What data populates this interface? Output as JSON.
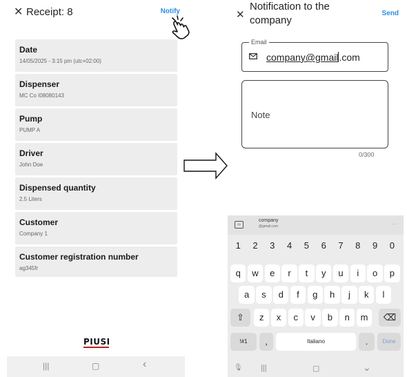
{
  "left": {
    "title": "Receipt: 8",
    "notify_label": "Notify",
    "close_icon": "close-icon",
    "cards": [
      {
        "label": "Date",
        "value": "14/05/2025 - 3:15 pm (utc+02:00)"
      },
      {
        "label": "Dispenser",
        "value": "MC Co  I08080143"
      },
      {
        "label": "Pump",
        "value": "PUMP A"
      },
      {
        "label": "Driver",
        "value": "John Doe"
      },
      {
        "label": "Dispensed quantity",
        "value": "2.5 Liters"
      },
      {
        "label": "Customer",
        "value": "Company 1"
      },
      {
        "label": "Customer registration number",
        "value": "ag345fr"
      }
    ],
    "logo": "PIUSI",
    "nav": {
      "recents": "|||",
      "home": "▢",
      "back": "‹"
    }
  },
  "right": {
    "title": "Notification to the company",
    "send_label": "Send",
    "email": {
      "legend": "Email",
      "value_part1": "company@gmail",
      "value_part2": ".com"
    },
    "note": {
      "placeholder": "Note",
      "counter": "0/300"
    },
    "keyboard": {
      "suggestion_name": "company",
      "suggestion_sub": "@gmail.com",
      "suggestion_more": "···",
      "clipboard_icon": "‹›",
      "row_num": [
        "1",
        "2",
        "3",
        "4",
        "5",
        "6",
        "7",
        "8",
        "9",
        "0"
      ],
      "row1": [
        "q",
        "w",
        "e",
        "r",
        "t",
        "y",
        "u",
        "i",
        "o",
        "p"
      ],
      "row2": [
        "a",
        "s",
        "d",
        "f",
        "g",
        "h",
        "j",
        "k",
        "l"
      ],
      "row3": [
        "z",
        "x",
        "c",
        "v",
        "b",
        "n",
        "m"
      ],
      "shift": "⇧",
      "backspace": "⌫",
      "symbols": "!#1",
      "comma": ",",
      "space": "Italiano",
      "period": ".",
      "done": "Done",
      "nav": {
        "mic": "🎙",
        "recents": "|||",
        "home": "▢",
        "hide": "⌄"
      }
    }
  },
  "arrow_icon": "right-arrow-icon"
}
